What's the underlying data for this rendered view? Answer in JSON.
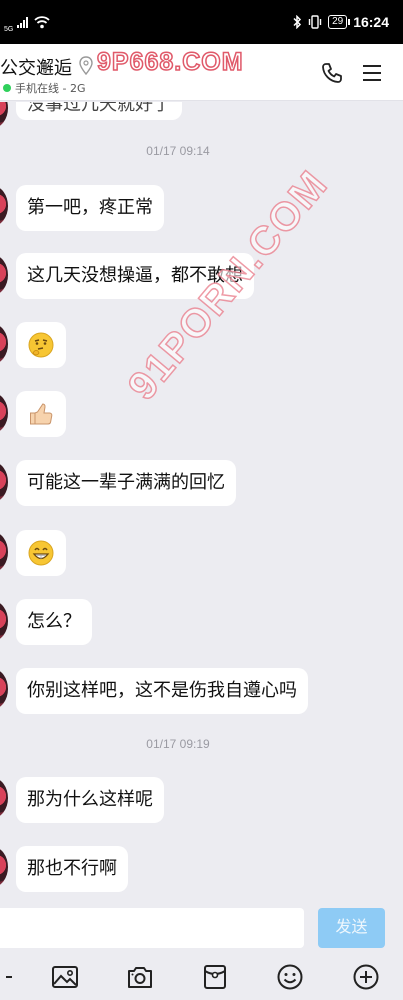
{
  "status_bar": {
    "network": "5G",
    "battery": "29",
    "time": "16:24"
  },
  "header": {
    "contact_name": "公交邂逅",
    "presence": "手机在线 - 2G",
    "watermark": "9P668.COM"
  },
  "watermark_diagonal": "91PORN.COM",
  "messages": [
    {
      "kind": "text",
      "text": "没事过几天就好了"
    },
    {
      "kind": "time",
      "text": "01/17 09:14"
    },
    {
      "kind": "text",
      "text": "第一吧，疼正常"
    },
    {
      "kind": "text",
      "text": "这几天没想操逼，都不敢想"
    },
    {
      "kind": "emoji",
      "icon": "thinking-face-icon"
    },
    {
      "kind": "emoji",
      "icon": "thumbs-up-icon"
    },
    {
      "kind": "text",
      "text": "可能这一辈子满满的回忆"
    },
    {
      "kind": "emoji",
      "icon": "grinning-face-icon"
    },
    {
      "kind": "text",
      "text": "怎么？"
    },
    {
      "kind": "text",
      "text": "你别这样吧，这不是伤我自遵心吗"
    },
    {
      "kind": "time",
      "text": "01/17 09:19"
    },
    {
      "kind": "text",
      "text": "那为什么这样呢"
    },
    {
      "kind": "text",
      "text": "那也不行啊"
    }
  ],
  "composer": {
    "input_value": "",
    "send_label": "发送"
  },
  "toolbar": {
    "icons": [
      "image-icon",
      "camera-icon",
      "red-packet-icon",
      "emoji-icon",
      "plus-icon"
    ]
  },
  "colors": {
    "send_button": "#8ecbf5",
    "online_dot": "#2fd05b",
    "watermark_stroke": "#e05a6a"
  }
}
